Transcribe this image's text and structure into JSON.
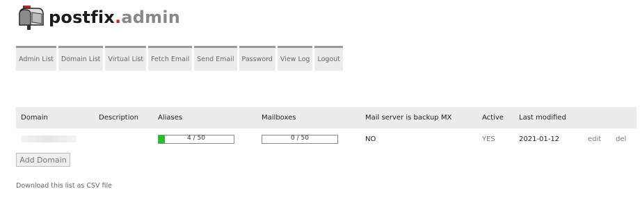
{
  "brand": {
    "part1": "postfix",
    "dot": ".",
    "part2": "admin",
    "icon": "mailbox-icon"
  },
  "menu": [
    "Admin List",
    "Domain List",
    "Virtual List",
    "Fetch Email",
    "Send Email",
    "Password",
    "View Log",
    "Logout"
  ],
  "table": {
    "headers": {
      "domain": "Domain",
      "description": "Description",
      "aliases": "Aliases",
      "mailboxes": "Mailboxes",
      "backup_mx": "Mail server is backup MX",
      "active": "Active",
      "last_modified": "Last modified"
    },
    "rows": [
      {
        "domain": "",
        "description": "",
        "aliases_text": "4 / 50",
        "aliases_fraction": 0.08,
        "mailboxes_text": "0 / 50",
        "mailboxes_fraction": 0.0,
        "backup_mx": "NO",
        "active": "YES",
        "last_modified": "2021-01-12",
        "edit": "edit",
        "del": "del"
      }
    ]
  },
  "add_domain_label": "Add Domain",
  "csv_link": "Download this list as CSV file",
  "colors": {
    "bar_fill": "#1ec41e",
    "logo_dot": "#cc1f1f"
  }
}
